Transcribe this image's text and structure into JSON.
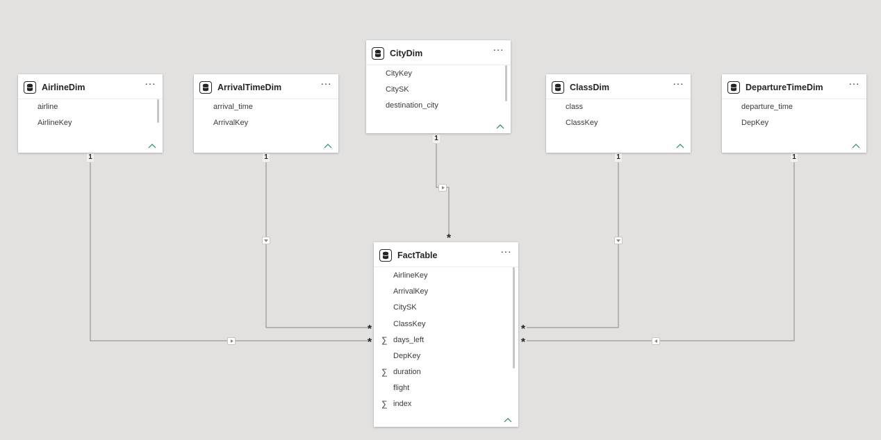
{
  "tables": {
    "airline_dim": {
      "title": "AirlineDim",
      "fields": [
        "airline",
        "AirlineKey"
      ]
    },
    "arrival_time_dim": {
      "title": "ArrivalTimeDim",
      "fields": [
        "arrival_time",
        "ArrivalKey"
      ]
    },
    "city_dim": {
      "title": "CityDim",
      "fields": [
        "CityKey",
        "CitySK",
        "destination_city"
      ]
    },
    "class_dim": {
      "title": "ClassDim",
      "fields": [
        "class",
        "ClassKey"
      ]
    },
    "departure_time_dim": {
      "title": "DepartureTimeDim",
      "fields": [
        "departure_time",
        "DepKey"
      ]
    },
    "fact_table": {
      "title": "FactTable",
      "fields": [
        "AirlineKey",
        "ArrivalKey",
        "CitySK",
        "ClassKey",
        "days_left",
        "DepKey",
        "duration",
        "flight",
        "index"
      ],
      "sigma_fields": [
        "days_left",
        "duration",
        "index"
      ]
    }
  },
  "menu_glyph": "···",
  "sigma_glyph": "∑",
  "relationships": {
    "one_label": "1",
    "many_label": "*"
  },
  "colors": {
    "canvas": "#e2e1e0",
    "line": "#8a8886",
    "card": "#ffffff",
    "text": "#252423",
    "collapse": "#1f8a70"
  }
}
